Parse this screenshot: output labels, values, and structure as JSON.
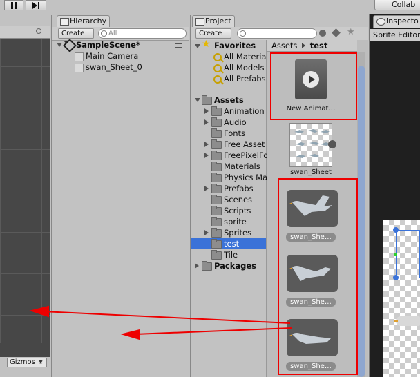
{
  "top_toolbar": {
    "collab_label": "Collab"
  },
  "hierarchy": {
    "tab_label": "Hierarchy",
    "create_label": "Create",
    "search_placeholder": "All",
    "scene_name": "SampleScene*",
    "items": [
      "Main Camera",
      "swan_Sheet_0"
    ]
  },
  "project": {
    "tab_label": "Project",
    "create_label": "Create",
    "favorites": {
      "label": "Favorites",
      "items": [
        "All Materia",
        "All Models",
        "All Prefabs"
      ]
    },
    "assets": {
      "label": "Assets",
      "folders": [
        "Animation",
        "Audio",
        "Fonts",
        "Free Asset",
        "FreePixelFo",
        "Materials",
        "Physics Ma",
        "Prefabs",
        "Scenes",
        "Scripts",
        "sprite",
        "Sprites",
        "test",
        "Tile"
      ]
    },
    "packages_label": "Packages",
    "breadcrumb": [
      "Assets",
      "test"
    ],
    "grid_items": [
      "New Animat…",
      "swan_Sheet",
      "swan_She…",
      "swan_She…",
      "swan_She…"
    ]
  },
  "inspector": {
    "tab_label": "Inspecto",
    "sprite_editor_label": "Sprite Editor"
  },
  "scene_bottom": {
    "gizmos_label": "Gizmos"
  },
  "colors": {
    "annotation_red": "#ee0000",
    "selection_blue": "#3a72d8"
  }
}
